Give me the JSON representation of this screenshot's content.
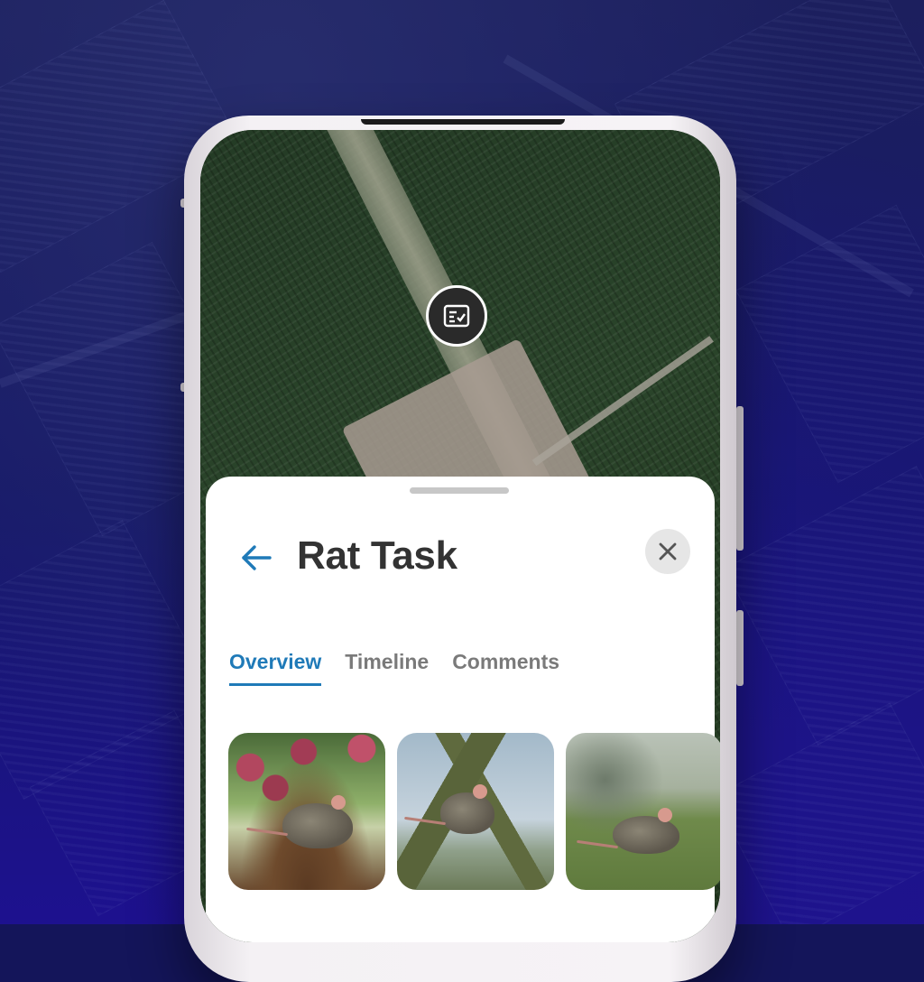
{
  "task": {
    "title": "Rat Task"
  },
  "tabs": [
    {
      "label": "Overview",
      "active": true
    },
    {
      "label": "Timeline",
      "active": false
    },
    {
      "label": "Comments",
      "active": false
    }
  ],
  "photos": [
    {
      "subject": "rat under apple tree"
    },
    {
      "subject": "rat climbing tree trunk"
    },
    {
      "subject": "rat in grass field"
    }
  ],
  "icons": {
    "map_pin": "task-checklist-icon",
    "back": "arrow-left-icon",
    "close": "close-icon"
  },
  "colors": {
    "accent": "#1f7ab8",
    "title": "#333333",
    "tab_inactive": "#7a7a7a",
    "close_button_bg": "#e6e6e6",
    "background": "#14155a"
  }
}
